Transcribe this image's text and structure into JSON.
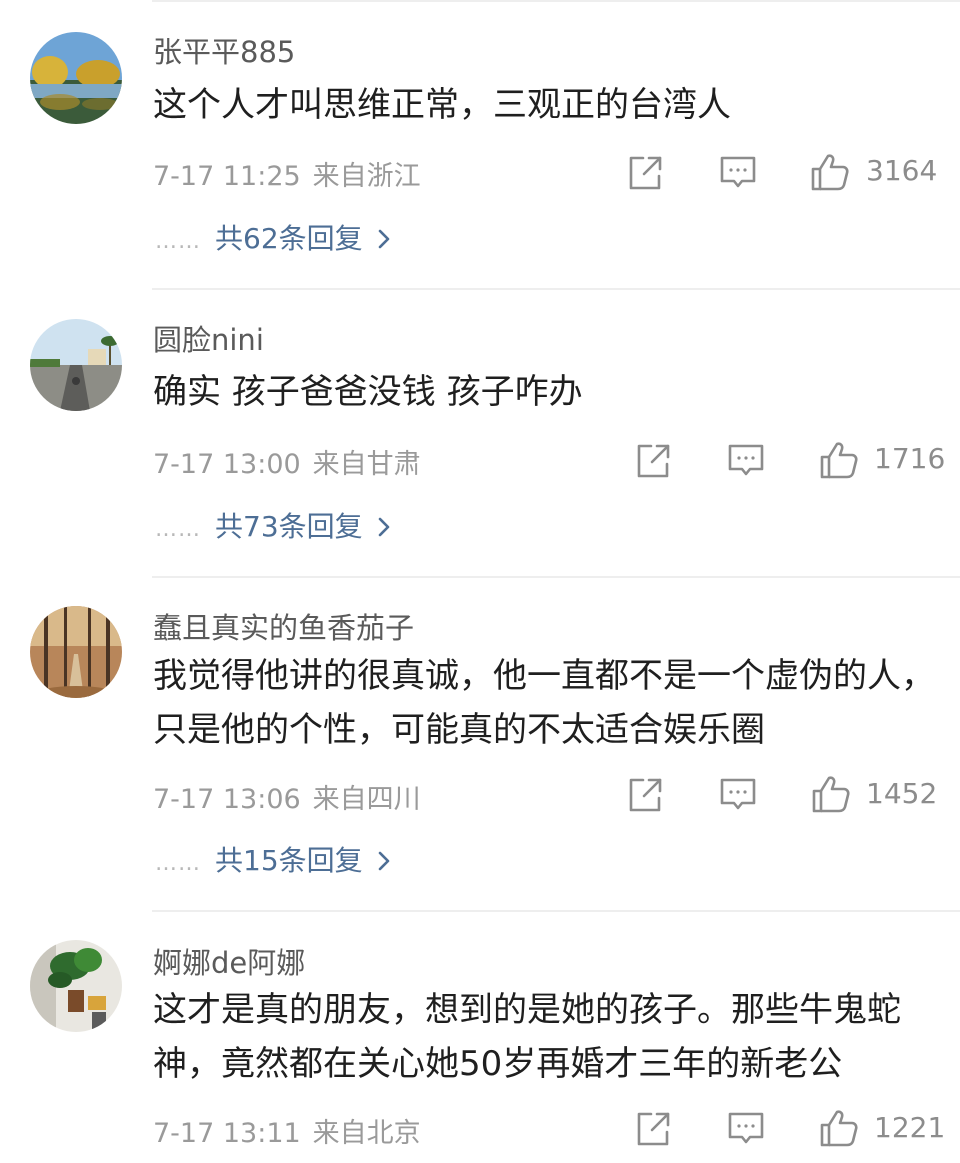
{
  "comments": [
    {
      "username": "张平平885",
      "content": "这个人才叫思维正常，三观正的台湾人",
      "time": "7-17 11:25",
      "location": "来自浙江",
      "likes": "3164",
      "replies_label": "共62条回复",
      "avatar": "lake-trees-photo"
    },
    {
      "username": "圆脸nini",
      "content": "确实  孩子爸爸没钱 孩子咋办",
      "time": "7-17 13:00",
      "location": "来自甘肃",
      "likes": "1716",
      "replies_label": "共73条回复",
      "avatar": "road-palm-photo"
    },
    {
      "username": "蠢且真实的鱼香茄子",
      "content": "我觉得他讲的很真诚，他一直都不是一个虚伪的人，只是他的个性，可能真的不太适合娱乐圈",
      "time": "7-17 13:06",
      "location": "来自四川",
      "likes": "1452",
      "replies_label": "共15条回复",
      "avatar": "autumn-forest-photo"
    },
    {
      "username": "婀娜de阿娜",
      "content": "这才是真的朋友，想到的是她的孩子。那些牛鬼蛇神，竟然都在关心她50岁再婚才三年的新老公",
      "time": "7-17 13:11",
      "location": "来自北京",
      "likes": "1221",
      "avatar": "plant-window-photo"
    }
  ],
  "replies_prefix": "……",
  "icons": {
    "share": "share-icon",
    "comment": "comment-icon",
    "like": "thumbs-up-icon",
    "more": "chevron-right-icon"
  },
  "colors": {
    "reply_link": "#4d6e95",
    "meta": "#9a9a9a",
    "divider": "#eeeeee"
  }
}
